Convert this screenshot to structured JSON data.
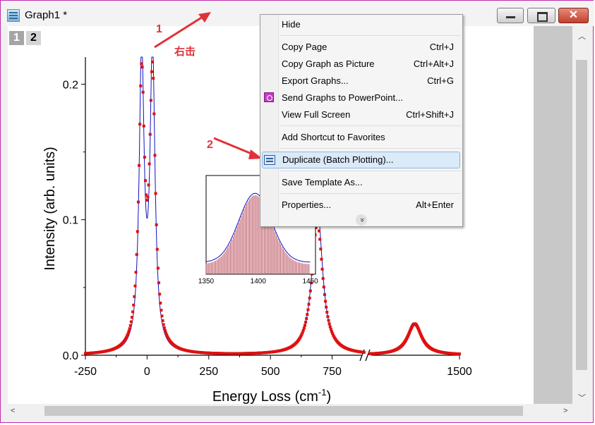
{
  "window": {
    "title": "Graph1 *",
    "close_glyph": "✕"
  },
  "layers": [
    "1",
    "2"
  ],
  "annotations": {
    "step1": "1",
    "right_click": "右击",
    "step2": "2"
  },
  "context_menu": {
    "items": [
      {
        "label": "Hide",
        "shortcut": ""
      },
      {
        "label": "Copy Page",
        "shortcut": "Ctrl+J"
      },
      {
        "label": "Copy Graph as Picture",
        "shortcut": "Ctrl+Alt+J"
      },
      {
        "label": "Export Graphs...",
        "shortcut": "Ctrl+G"
      },
      {
        "label": "Send Graphs to PowerPoint...",
        "shortcut": ""
      },
      {
        "label": "View Full Screen",
        "shortcut": "Ctrl+Shift+J"
      },
      {
        "label": "Add Shortcut to Favorites",
        "shortcut": ""
      },
      {
        "label": "Duplicate (Batch Plotting)...",
        "shortcut": ""
      },
      {
        "label": "Save Template As...",
        "shortcut": ""
      },
      {
        "label": "Properties...",
        "shortcut": "Alt+Enter"
      }
    ],
    "expand_glyph": "»"
  },
  "chart_data": {
    "type": "line",
    "xlabel": "Energy Loss (cm",
    "xlabel_sup": "-1",
    "xlabel_end": ")",
    "ylabel": "Intensity (arb. units)",
    "x_ticks": [
      "-250",
      "0",
      "250",
      "500",
      "750",
      "1500"
    ],
    "y_ticks": [
      "0.0",
      "0.1",
      "0.2"
    ],
    "xlim_left": [
      -250,
      880
    ],
    "xlim_right_segment": [
      1180,
      1500
    ],
    "ylim": [
      0,
      0.22
    ],
    "series": [
      {
        "style": "line",
        "color": "#1010c0",
        "peaks": [
          {
            "x": -22,
            "amp": 0.22,
            "w": 12
          },
          {
            "x": 22,
            "amp": 0.22,
            "w": 12
          },
          {
            "x": 690,
            "amp": 0.11,
            "w": 25
          }
        ]
      },
      {
        "style": "scatter",
        "color": "#e01010",
        "peaks": [
          {
            "x": -22,
            "amp": 0.198,
            "w": 14
          },
          {
            "x": 22,
            "amp": 0.198,
            "w": 14
          },
          {
            "x": 690,
            "amp": 0.098,
            "w": 27
          },
          {
            "x": 1340,
            "amp": 0.023,
            "w": 30
          }
        ]
      }
    ],
    "inset": {
      "x_ticks": [
        "1350",
        "1400",
        "1450"
      ],
      "xlim": [
        1350,
        1455
      ],
      "ylim": [
        0,
        1
      ]
    }
  }
}
